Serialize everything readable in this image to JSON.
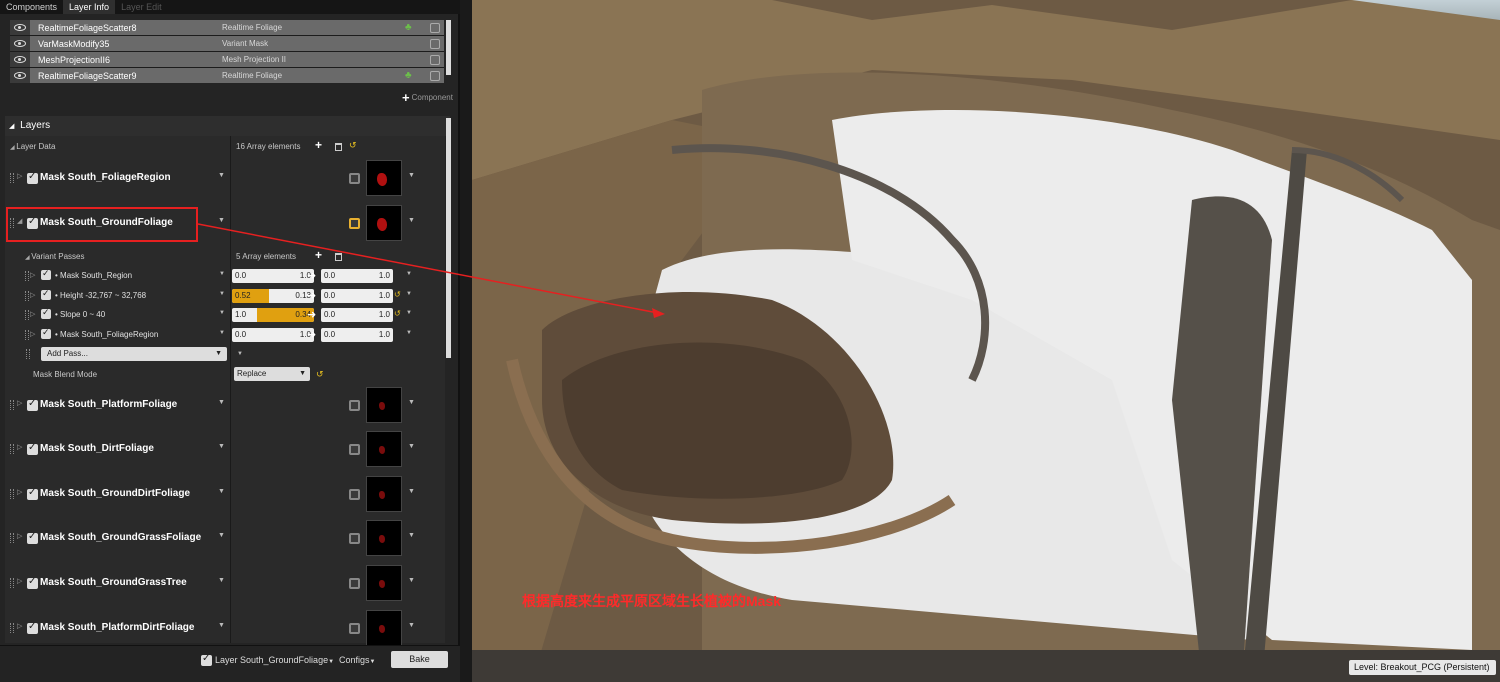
{
  "tabs": [
    {
      "label": "Components"
    },
    {
      "label": "Layer Info"
    },
    {
      "label": "Layer Edit"
    }
  ],
  "components": [
    {
      "name": "RealtimeFoliageScatter8",
      "type": "Realtime Foliage",
      "has_tree_icon": true
    },
    {
      "name": "VarMaskModify35",
      "type": "Variant Mask",
      "has_tree_icon": false
    },
    {
      "name": "MeshProjectionII6",
      "type": "Mesh Projection II",
      "has_tree_icon": false
    },
    {
      "name": "RealtimeFoliageScatter9",
      "type": "Realtime Foliage",
      "has_tree_icon": true
    }
  ],
  "add_component_label": "Component",
  "layers": {
    "header": "Layers",
    "layer_data_label": "Layer Data",
    "layer_data_count": "16 Array elements",
    "masks": [
      {
        "name": "Mask South_FoliageRegion"
      },
      {
        "name": "Mask South_GroundFoliage",
        "expanded": true,
        "active": true
      },
      {
        "name": "Mask South_PlatformFoliage"
      },
      {
        "name": "Mask South_DirtFoliage"
      },
      {
        "name": "Mask South_GroundDirtFoliage"
      },
      {
        "name": "Mask South_GroundGrassFoliage"
      },
      {
        "name": "Mask South_GroundGrassTree"
      },
      {
        "name": "Mask South_PlatformDirtFoliage"
      }
    ],
    "variant_passes_label": "Variant Passes",
    "variant_passes_count": "5 Array elements",
    "passes": [
      {
        "name": "• Mask South_Region",
        "in_min": "0.0",
        "in_max": "1.0",
        "out_min": "0.0",
        "out_max": "1.0",
        "fill_start": 0,
        "fill_end": 0,
        "has_reset": false
      },
      {
        "name": "• Height -32,767 ~ 32,768",
        "in_min": "0.52",
        "in_max": "0.13",
        "out_min": "0.0",
        "out_max": "1.0",
        "fill_start": 0,
        "fill_end": 0.45,
        "has_reset": true
      },
      {
        "name": "• Slope 0 ~ 40",
        "in_min": "1.0",
        "in_max": "0.34",
        "out_min": "0.0",
        "out_max": "1.0",
        "fill_start": 0.3,
        "fill_end": 1.0,
        "has_reset": true
      },
      {
        "name": "• Mask South_FoliageRegion",
        "in_min": "0.0",
        "in_max": "1.0",
        "out_min": "0.0",
        "out_max": "1.0",
        "fill_start": 0,
        "fill_end": 0,
        "has_reset": false
      }
    ],
    "add_pass_label": "Add Pass...",
    "blend_mode_label": "Mask Blend Mode",
    "blend_mode_value": "Replace"
  },
  "bottom": {
    "layer_selector": "Layer South_GroundFoliage",
    "configs_label": "Configs",
    "bake_label": "Bake"
  },
  "viewport": {
    "caption": "根据高度来生成平原区域生长植被的Mask",
    "level_label": "Level:  Breakout_PCG (Persistent)"
  },
  "colors": {
    "highlight": "#e62020",
    "accent": "#e0a010",
    "caption": "#ff2a2a"
  }
}
